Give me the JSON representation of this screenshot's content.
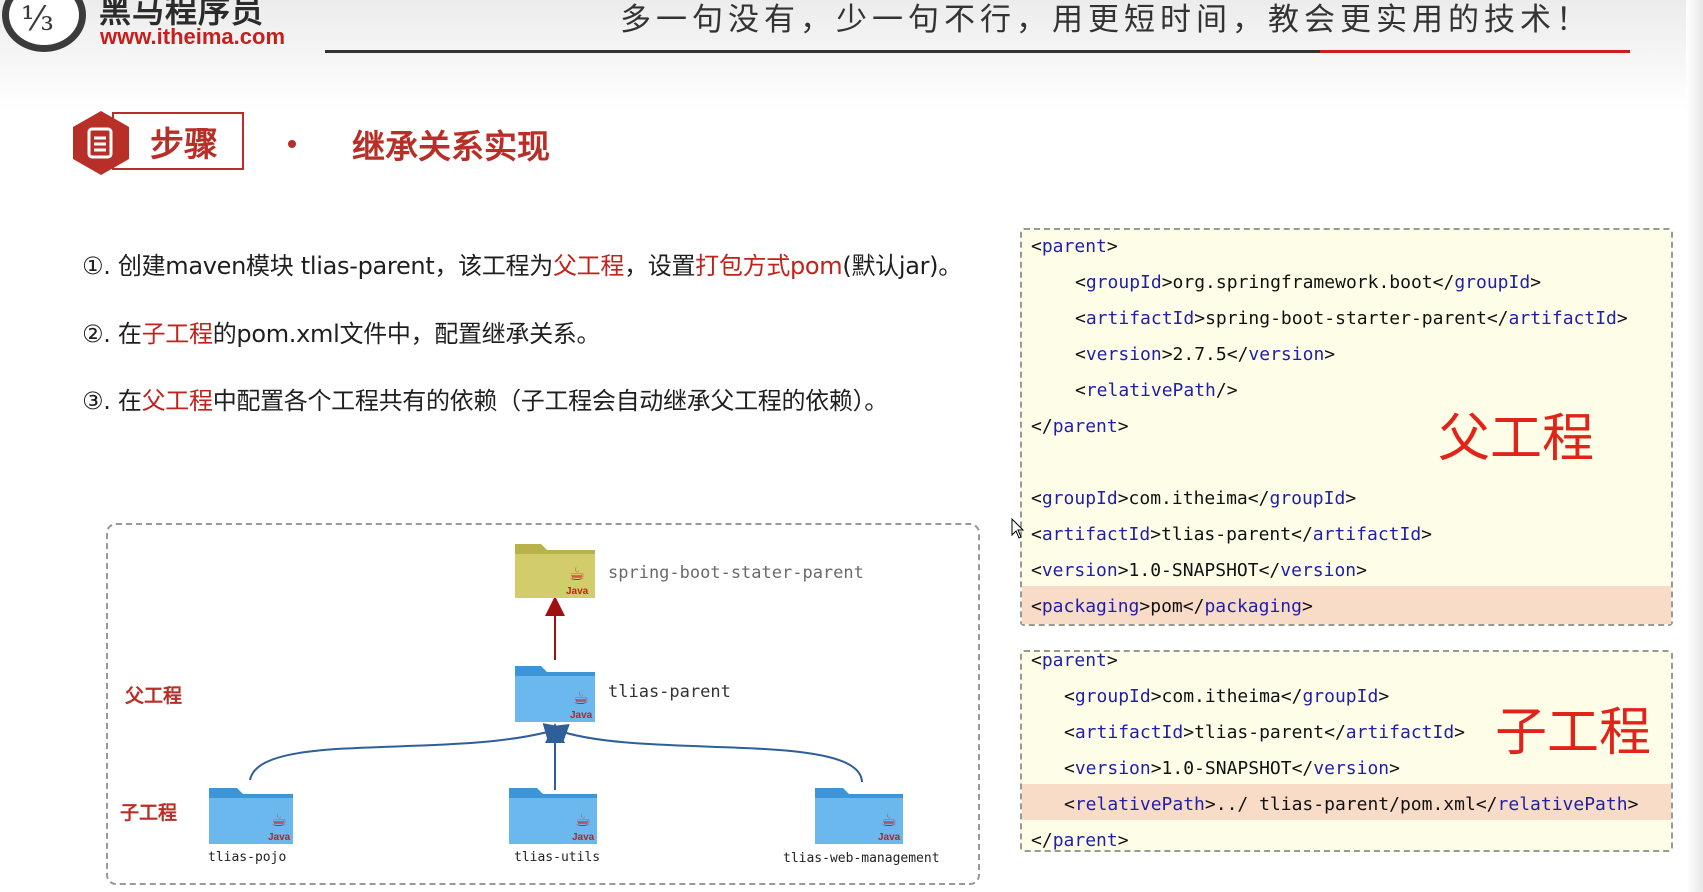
{
  "header": {
    "brand_name": "黑马程序员",
    "brand_url": "www.itheima.com",
    "slogan": "多一句没有，少一句不行，用更短时间，教会更实用的技术！",
    "logo_icon": "heima-logo-icon"
  },
  "section": {
    "badge_label": "步骤",
    "badge_icon": "document-icon",
    "title": "继承关系实现"
  },
  "steps": [
    {
      "prefix": "①. 创建maven模块 tlias-parent，该工程为",
      "red1": "父工程",
      "mid": "，设置",
      "red2": "打包方式pom",
      "suffix": "(默认jar)。"
    },
    {
      "prefix": "②. 在",
      "red1": "子工程",
      "suffix": "的pom.xml文件中，配置继承关系。"
    },
    {
      "prefix": "③. 在",
      "red1": "父工程",
      "suffix": "中配置各个工程共有的依赖（子工程会自动继承父工程的依赖）。"
    }
  ],
  "diagram": {
    "label_parent": "父工程",
    "label_child": "子工程",
    "top_module": "spring-boot-stater-parent",
    "parent_module": "tlias-parent",
    "children": [
      "tlias-pojo",
      "tlias-utils",
      "tlias-web-management"
    ],
    "folder_badge": "Java",
    "colors": {
      "folder_blue": "#5aaee8",
      "folder_olive": "#c8c25e",
      "arrow_red": "#a01010",
      "arrow_blue": "#2f5f9a"
    }
  },
  "parent_code": {
    "label": "父工程",
    "lines": [
      {
        "indent": 0,
        "open": "<parent>"
      },
      {
        "indent": 1,
        "open": "<groupId>",
        "value": "org.springframework.boot",
        "close": "</groupId>"
      },
      {
        "indent": 1,
        "open": "<artifactId>",
        "value": "spring-boot-starter-parent",
        "close": "</artifactId>"
      },
      {
        "indent": 1,
        "open": "<version>",
        "value": "2.7.5",
        "close": "</version>"
      },
      {
        "indent": 1,
        "open": "<relativePath/>"
      },
      {
        "indent": 0,
        "open": "</parent>"
      },
      {
        "indent": 0,
        "open": "<groupId>",
        "value": "com.itheima",
        "close": "</groupId>"
      },
      {
        "indent": 0,
        "open": "<artifactId>",
        "value": "tlias-parent",
        "close": "</artifactId>"
      },
      {
        "indent": 0,
        "open": "<version>",
        "value": "1.0-SNAPSHOT",
        "close": "</version>"
      },
      {
        "indent": 0,
        "open": "<packaging>",
        "value": "pom",
        "close": "</packaging>",
        "highlight": true
      }
    ]
  },
  "child_code": {
    "label": "子工程",
    "lines": [
      {
        "indent": 0,
        "open": "<parent>"
      },
      {
        "indent": 1,
        "open": "<groupId>",
        "value": "com.itheima",
        "close": "</groupId>"
      },
      {
        "indent": 1,
        "open": "<artifactId>",
        "value": "tlias-parent",
        "close": "</artifactId>"
      },
      {
        "indent": 1,
        "open": "<version>",
        "value": "1.0-SNAPSHOT",
        "close": "</version>"
      },
      {
        "indent": 1,
        "open": "<relativePath>",
        "value": "../ tlias-parent/pom.xml",
        "close": "</relativePath>",
        "highlight": true
      },
      {
        "indent": 0,
        "open": "</parent>"
      }
    ]
  },
  "colors": {
    "accent_red": "#b82f27",
    "code_bg": "#fdfde8",
    "highlight_bg": "#f8dcc8",
    "tag_blue": "#1f1fa8"
  }
}
